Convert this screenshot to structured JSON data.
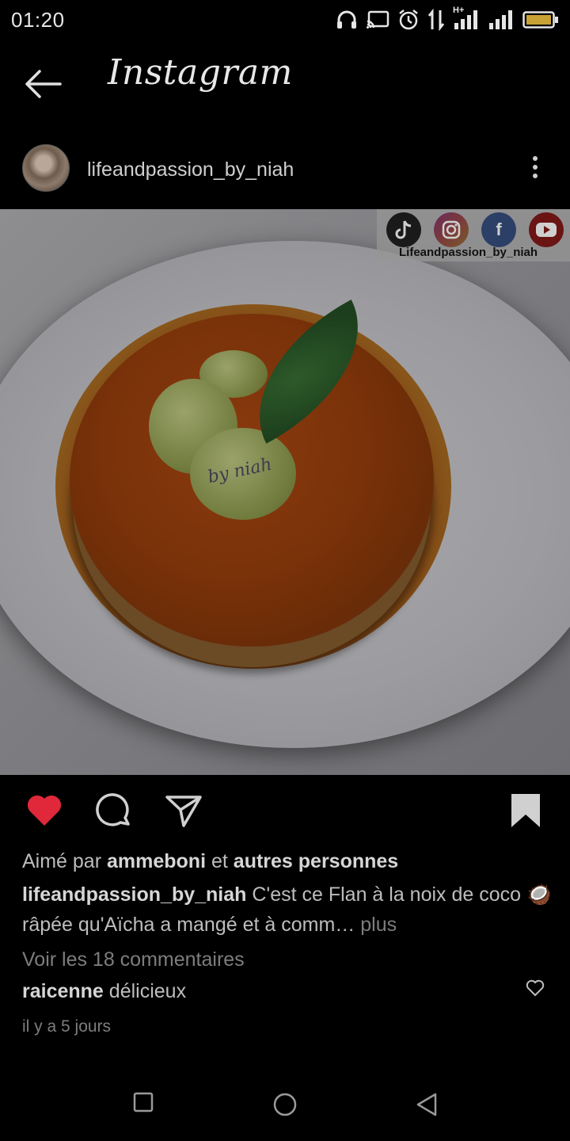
{
  "status_bar": {
    "time": "01:20",
    "network_label": "H+",
    "icons": [
      "headphones-icon",
      "cast-icon",
      "alarm-icon",
      "data-transfer-icon",
      "signal-icon",
      "signal-icon",
      "battery-icon"
    ]
  },
  "app_bar": {
    "title": "Instagram",
    "back_icon": "arrow-left-icon"
  },
  "post": {
    "username": "lifeandpassion_by_niah",
    "image": {
      "social_caption": "Lifeandpassion_by_niah",
      "social_icons": [
        "tiktok-icon",
        "instagram-icon",
        "facebook-icon",
        "youtube-icon"
      ],
      "watermark": "by niah"
    },
    "actions": {
      "liked": true,
      "like_color": "#e0283a"
    },
    "likes": {
      "prefix": "Aimé par",
      "user": "ammeboni",
      "conj": "et",
      "others": "autres personnes"
    },
    "caption": {
      "user": "lifeandpassion_by_niah",
      "text": "C'est ce Flan à la noix de coco 🥥râpée qu'Aïcha a mangé et à comm…",
      "more": "plus"
    },
    "view_comments": "Voir les 18 commentaires",
    "comment": {
      "user": "raicenne",
      "text": "délicieux"
    },
    "timestamp": "il y a 5 jours"
  },
  "nav_bar": {
    "buttons": [
      "recent-apps-icon",
      "home-icon",
      "back-icon"
    ]
  }
}
